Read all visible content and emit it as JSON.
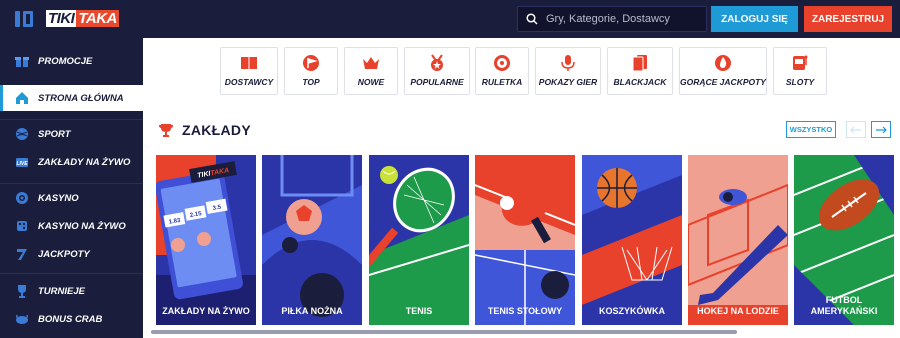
{
  "header": {
    "logo_part1": "TIKI",
    "logo_part2": "TAKA",
    "search_placeholder": "Gry, Kategorie, Dostawcy",
    "login_label": "ZALOGUJ SIĘ",
    "register_label": "ZAREJESTRUJ"
  },
  "sidebar": {
    "items": [
      {
        "label": "PROMOCJE",
        "icon": "gift-icon"
      },
      {
        "label": "STRONA GŁÓWNA",
        "icon": "home-icon",
        "active": true
      },
      {
        "label": "SPORT",
        "icon": "ball-icon"
      },
      {
        "label": "ZAKŁADY NA ŻYWO",
        "icon": "live-icon"
      },
      {
        "label": "KASYNO",
        "icon": "chip-icon"
      },
      {
        "label": "KASYNO NA ŻYWO",
        "icon": "live-casino-icon"
      },
      {
        "label": "JACKPOTY",
        "icon": "seven-icon"
      },
      {
        "label": "TURNIEJE",
        "icon": "trophy-icon"
      },
      {
        "label": "BONUS CRAB",
        "icon": "crab-icon"
      }
    ]
  },
  "categories": [
    {
      "label": "DOSTAWCY",
      "icon": "book-icon"
    },
    {
      "label": "TOP",
      "icon": "flag-icon"
    },
    {
      "label": "NOWE",
      "icon": "crown-icon"
    },
    {
      "label": "POPULARNE",
      "icon": "medal-icon"
    },
    {
      "label": "RULETKA",
      "icon": "roulette-icon"
    },
    {
      "label": "POKAZY GIER",
      "icon": "microphone-icon"
    },
    {
      "label": "BLACKJACK",
      "icon": "cards-icon"
    },
    {
      "label": "GORĄCE JACKPOTY",
      "icon": "fire-icon"
    },
    {
      "label": "SLOTY",
      "icon": "slot-machine-icon"
    }
  ],
  "section": {
    "title": "ZAKŁADY",
    "all_label": "WSZYSTKO",
    "prev_arrow": "←",
    "next_arrow": "→"
  },
  "sports": [
    {
      "label": "ZAKŁADY NA ŻYWO",
      "logo_part1": "TIKI",
      "logo_part2": "TAKA",
      "score1": "1.83",
      "score2": "2.15",
      "score3": "3.5"
    },
    {
      "label": "PIŁKA NOŻNA"
    },
    {
      "label": "TENIS"
    },
    {
      "label": "TENIS STOŁOWY"
    },
    {
      "label": "KOSZYKÓWKA"
    },
    {
      "label": "HOKEJ NA LODZIE"
    },
    {
      "label": "FUTBOL AMERYKAŃSKI"
    }
  ],
  "colors": {
    "navy": "#1a1d3b",
    "blue": "#1e9bd7",
    "red": "#e8412c",
    "card_blue": "#2b35a8",
    "card_green": "#1d9a4a",
    "card_salmon": "#f0a090"
  }
}
